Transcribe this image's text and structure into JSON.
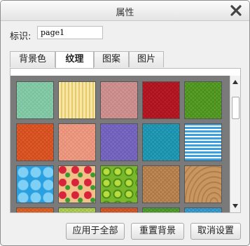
{
  "dialog": {
    "title": "属性",
    "close_icon": "close-icon"
  },
  "id_field": {
    "label": "标识:",
    "value": "page1"
  },
  "tabs": [
    {
      "label": "背景色",
      "active": false
    },
    {
      "label": "纹理",
      "active": true
    },
    {
      "label": "图案",
      "active": false
    },
    {
      "label": "图片",
      "active": false
    }
  ],
  "textures": [
    {
      "name": "mint-check",
      "color": "#8fd1b0",
      "alt": "#7cc3a0",
      "pattern": "check"
    },
    {
      "name": "cream-stripes",
      "color": "#f7e7a6",
      "alt": "#e8c96a",
      "pattern": "vstripes"
    },
    {
      "name": "rose-check",
      "color": "#d69a9a",
      "alt": "#c78888",
      "pattern": "check"
    },
    {
      "name": "red-check",
      "color": "#c81e2a",
      "alt": "#a81420",
      "pattern": "check"
    },
    {
      "name": "green-check",
      "color": "#5fa82c",
      "alt": "#4c9020",
      "pattern": "check"
    },
    {
      "name": "orange-check",
      "color": "#e8602c",
      "alt": "#d04e20",
      "pattern": "check"
    },
    {
      "name": "salmon-check",
      "color": "#f4a38c",
      "alt": "#e69078",
      "pattern": "check"
    },
    {
      "name": "purple-check",
      "color": "#8070c8",
      "alt": "#6f5fb8",
      "pattern": "check"
    },
    {
      "name": "teal-check",
      "color": "#2aa5c0",
      "alt": "#1c90aa",
      "pattern": "check"
    },
    {
      "name": "blue-stripes",
      "color": "#3aa0e0",
      "alt": "#ffffff",
      "pattern": "hstripes"
    },
    {
      "name": "blue-stars",
      "color": "#2aa0e0",
      "alt": "#1488c8",
      "pattern": "stars"
    },
    {
      "name": "strawberry",
      "color": "#f4c08a",
      "alt": "#d8243a",
      "pattern": "fruit"
    },
    {
      "name": "green-circles",
      "color": "#78b82a",
      "alt": "#b8dc40",
      "pattern": "circles"
    },
    {
      "name": "tan-weave",
      "color": "#c8905a",
      "alt": "#b07a48",
      "pattern": "check"
    },
    {
      "name": "wood-grain",
      "color": "#c89660",
      "alt": "#b07a46",
      "pattern": "wood"
    },
    {
      "name": "orange-row5",
      "color": "#e86a30",
      "alt": "#d05a20",
      "pattern": "check"
    },
    {
      "name": "lime-row5",
      "color": "#b8d860",
      "alt": "#a0c048",
      "pattern": "check"
    },
    {
      "name": "orange2-row5",
      "color": "#e06030",
      "alt": "#c85020",
      "pattern": "check"
    },
    {
      "name": "green-row5",
      "color": "#58a838",
      "alt": "#489028",
      "pattern": "check"
    },
    {
      "name": "blue-row5",
      "color": "#40a8d8",
      "alt": "#3090c0",
      "pattern": "check"
    }
  ],
  "buttons": {
    "apply_all": "应用于全部",
    "reset_bg": "重置背景",
    "cancel": "取消设置"
  }
}
